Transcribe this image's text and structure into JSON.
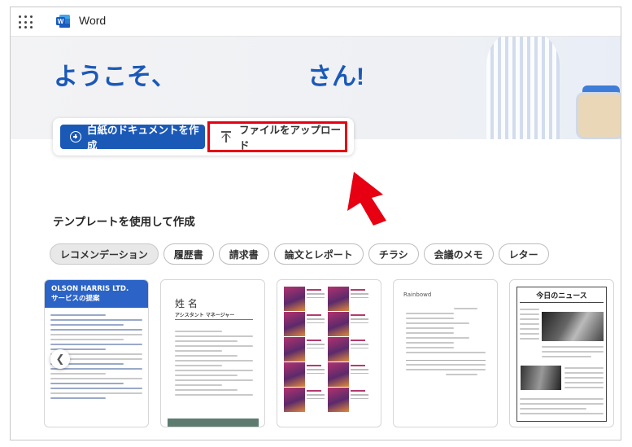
{
  "app": {
    "name": "Word",
    "waffle_icon": "app-launcher-icon",
    "logo_icon": "word-logo-icon",
    "accent": "#1b59b7"
  },
  "hero": {
    "greeting_prefix": "ようこそ、",
    "greeting_suffix": "さん!"
  },
  "actions": {
    "new_blank_label": "白紙のドキュメントを作成",
    "upload_label": "ファイルをアップロード",
    "highlight_color": "#e60012"
  },
  "templates": {
    "section_title": "テンプレートを使用して作成",
    "filters": [
      {
        "label": "レコメンデーション",
        "selected": true
      },
      {
        "label": "履歴書",
        "selected": false
      },
      {
        "label": "請求書",
        "selected": false
      },
      {
        "label": "論文とレポート",
        "selected": false
      },
      {
        "label": "チラシ",
        "selected": false
      },
      {
        "label": "会議のメモ",
        "selected": false
      },
      {
        "label": "レター",
        "selected": false
      }
    ],
    "cards": [
      {
        "heading": "OLSON HARRIS LTD.",
        "subheading": "サービスの提案"
      },
      {
        "name": "姓 名",
        "role": "アシスタント マネージャー"
      },
      {
        "label": "Bella Person"
      },
      {
        "label": "Rainbowd"
      },
      {
        "title": "今日のニュース"
      }
    ]
  }
}
